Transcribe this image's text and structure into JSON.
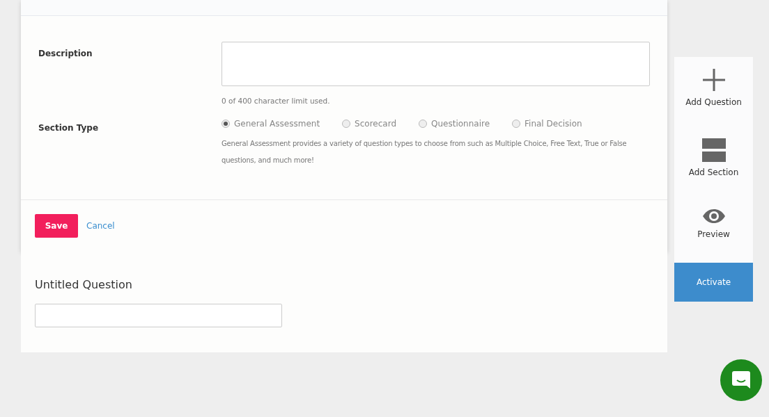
{
  "section_form": {
    "description": {
      "label": "Description",
      "hint": "0 of 400 character limit used."
    },
    "section_type": {
      "label": "Section Type",
      "options": [
        {
          "label": "General Assessment",
          "selected": true
        },
        {
          "label": "Scorecard",
          "selected": false
        },
        {
          "label": "Questionnaire",
          "selected": false
        },
        {
          "label": "Final Decision",
          "selected": false
        }
      ],
      "help": "General Assessment provides a variety of question types to choose from such as Multiple Choice, Free Text, True or False questions, and much more!"
    },
    "buttons": {
      "save": "Save",
      "cancel": "Cancel"
    }
  },
  "question": {
    "title": "Untitled Question"
  },
  "toolbar": {
    "items": [
      {
        "kind": "add",
        "label": "Add Question"
      },
      {
        "kind": "section",
        "label": "Add Section"
      },
      {
        "kind": "preview",
        "label": "Preview"
      }
    ],
    "activate": "Activate"
  }
}
